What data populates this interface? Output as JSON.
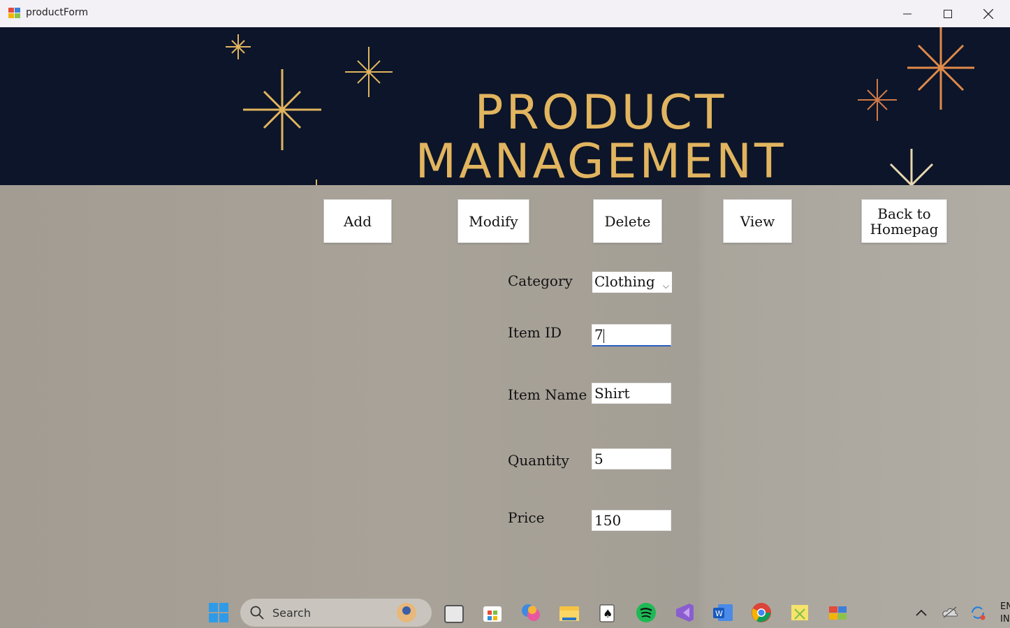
{
  "window": {
    "title": "productForm"
  },
  "banner": {
    "line1": "PRODUCT",
    "line2": "MANAGEMENT"
  },
  "toolbar": {
    "add": "Add",
    "modify": "Modify",
    "delete": "Delete",
    "view": "View",
    "back_line1": "Back to",
    "back_line2": "Homepag"
  },
  "form": {
    "category_label": "Category",
    "category_value": "Clothing",
    "item_id_label": "Item ID",
    "item_id_value": "7",
    "item_name_label": "Item Name",
    "item_name_value": "Shirt",
    "quantity_label": "Quantity",
    "quantity_value": "5",
    "price_label": "Price",
    "price_value": "150"
  },
  "taskbar": {
    "search_label": "Search",
    "tray_lang_line1": "EN",
    "tray_lang_line2": "IN"
  },
  "colors": {
    "banner_bg": "#0c1529",
    "banner_text": "#e1b45f",
    "content_bg": "#a39d94"
  }
}
